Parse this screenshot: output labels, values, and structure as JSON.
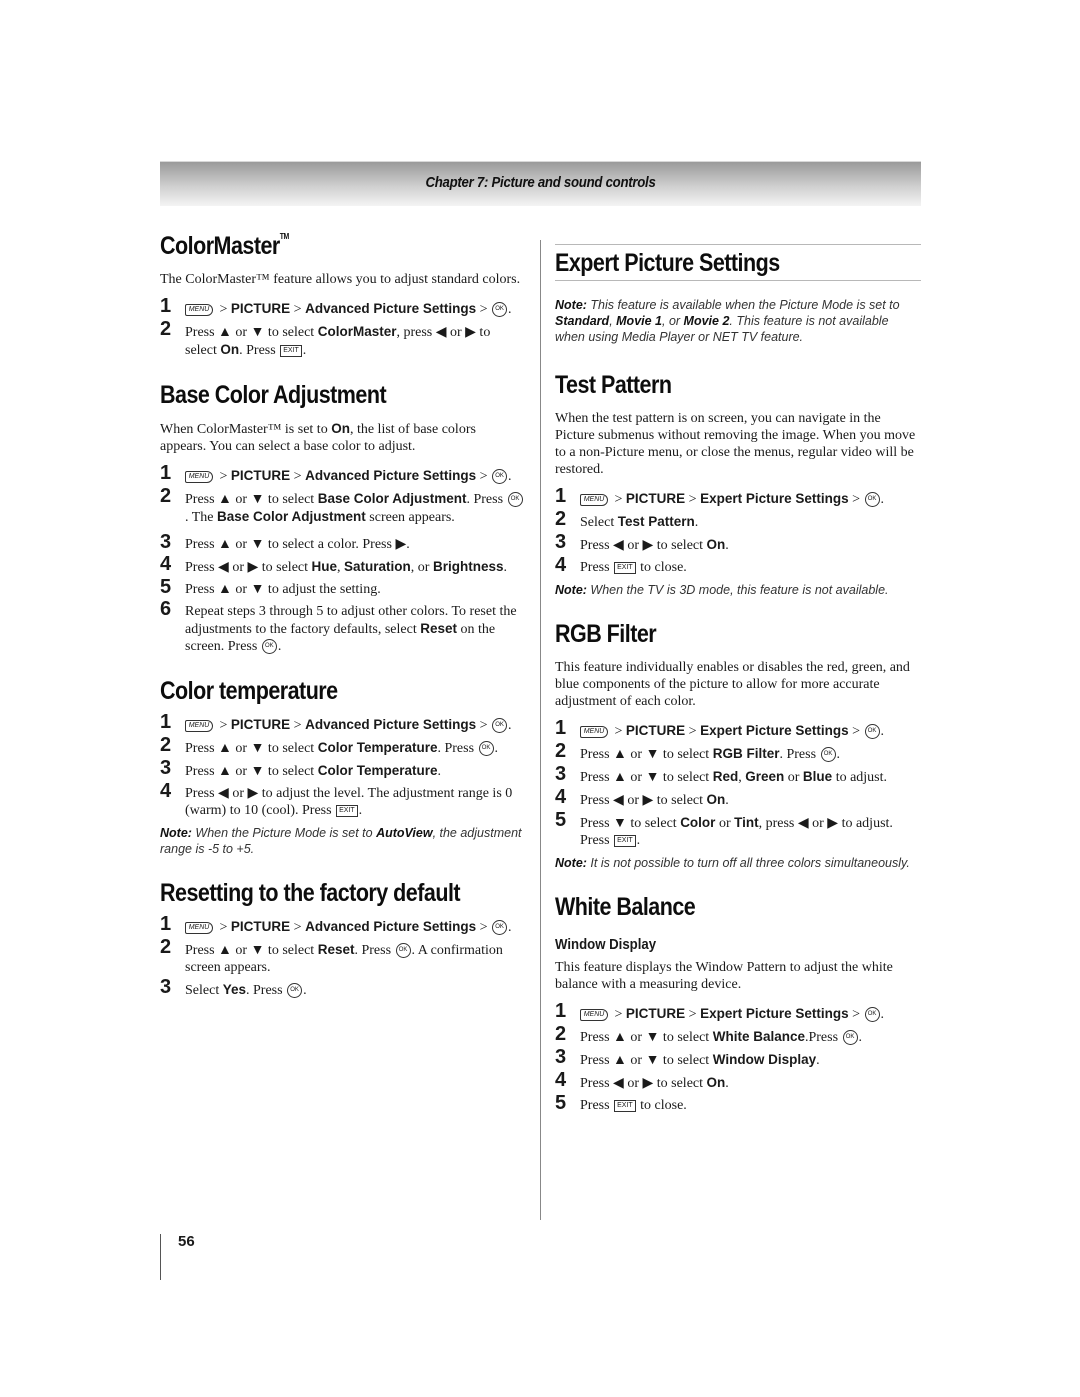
{
  "header": {
    "chapter_title": "Chapter 7: Picture and sound controls"
  },
  "left": {
    "colormaster": {
      "title": "ColorMaster",
      "title_tm": "TM",
      "intro": "The ColorMaster™ feature allows you to adjust standard colors.",
      "steps": [
        {
          "n": "1",
          "menu": "MENU",
          "path": [
            "PICTURE",
            "Advanced Picture Settings"
          ],
          "ok": "OK"
        },
        {
          "n": "2",
          "text_a": "Press ▲ or ▼ to select ",
          "bold_a": "ColorMaster",
          "text_b": ", press ◀ or ▶ to select ",
          "bold_b": "On",
          "text_c": ". Press ",
          "exit": "EXIT",
          "text_d": "."
        }
      ]
    },
    "base_color": {
      "title": "Base Color Adjustment",
      "intro_a": "When ColorMaster™ is set to ",
      "intro_bold": "On",
      "intro_b": ", the list of base colors appears. You can select a base color to adjust.",
      "steps": [
        {
          "n": "1",
          "menu": "MENU",
          "path": [
            "PICTURE",
            "Advanced Picture Settings"
          ],
          "ok": "OK"
        },
        {
          "n": "2",
          "text_a": "Press ▲ or ▼ to select ",
          "bold_a": "Base Color Adjustment",
          "text_b": ". Press ",
          "ok": "OK",
          "text_c": ". The ",
          "bold_b": "Base Color Adjustment",
          "text_d": " screen appears."
        },
        {
          "n": "3",
          "text": "Press ▲ or ▼ to select a color. Press ▶."
        },
        {
          "n": "4",
          "text_a": "Press ◀ or ▶ to select ",
          "bold_a": "Hue",
          "sep1": ", ",
          "bold_b": "Saturation",
          "sep2": ", or ",
          "bold_c": "Brightness",
          "end": "."
        },
        {
          "n": "5",
          "text": "Press ▲ or ▼ to adjust the setting."
        },
        {
          "n": "6",
          "text_a": "Repeat steps 3 through 5 to adjust other colors. To reset the adjustments to the factory defaults, select ",
          "bold_a": "Reset",
          "text_b": " on the screen. Press ",
          "ok": "OK",
          "end": "."
        }
      ]
    },
    "color_temp": {
      "title": "Color temperature",
      "steps": [
        {
          "n": "1",
          "menu": "MENU",
          "path": [
            "PICTURE",
            "Advanced Picture Settings"
          ],
          "ok": "OK"
        },
        {
          "n": "2",
          "text_a": "Press ▲ or ▼ to select ",
          "bold_a": "Color Temperature",
          "text_b": ". Press ",
          "ok": "OK",
          "end": "."
        },
        {
          "n": "3",
          "text_a": "Press ▲ or ▼ to select ",
          "bold_a": "Color Temperature",
          "end": "."
        },
        {
          "n": "4",
          "text_a": "Press ◀ or ▶ to adjust the level. The adjustment range is 0 (warm) to 10 (cool). Press ",
          "exit": "EXIT",
          "end": "."
        }
      ],
      "note_label": "Note:",
      "note_a": " When the Picture Mode is set to ",
      "note_bold": "AutoView",
      "note_b": ", the adjustment range is -5 to +5."
    },
    "reset": {
      "title": "Resetting to the factory default",
      "steps": [
        {
          "n": "1",
          "menu": "MENU",
          "path": [
            "PICTURE",
            "Advanced Picture Settings"
          ],
          "ok": "OK"
        },
        {
          "n": "2",
          "text_a": "Press ▲ or ▼ to select ",
          "bold_a": "Reset",
          "text_b": ". Press ",
          "ok": "OK",
          "text_c": ". A confirmation screen appears."
        },
        {
          "n": "3",
          "text_a": "Select ",
          "bold_a": "Yes",
          "text_b": ". Press ",
          "ok": "OK",
          "end": "."
        }
      ]
    }
  },
  "right": {
    "expert": {
      "title": "Expert Picture Settings",
      "note_label": "Note:",
      "note_a": " This feature is available when the Picture Mode is set to ",
      "note_b1": "Standard",
      "note_sep1": ", ",
      "note_b2": "Movie 1",
      "note_sep2": ", or ",
      "note_b3": "Movie 2",
      "note_c": ". This feature is not available when using Media Player or NET TV feature."
    },
    "test_pattern": {
      "title": "Test Pattern",
      "intro": "When the test pattern is on screen, you can navigate in the Picture submenus without removing the image. When you move to a non-Picture menu, or close the menus, regular video will be restored.",
      "steps": [
        {
          "n": "1",
          "menu": "MENU",
          "path": [
            "PICTURE",
            "Expert Picture Settings"
          ],
          "ok": "OK"
        },
        {
          "n": "2",
          "text_a": "Select ",
          "bold_a": "Test Pattern",
          "end": "."
        },
        {
          "n": "3",
          "text_a": "Press ◀ or ▶ to select ",
          "bold_a": "On",
          "end": "."
        },
        {
          "n": "4",
          "text_a": "Press ",
          "exit": "EXIT",
          "text_b": " to close."
        }
      ],
      "note_label": "Note:",
      "note": " When the TV is 3D mode, this feature is not available."
    },
    "rgb": {
      "title": "RGB Filter",
      "intro": "This feature individually enables or disables the red, green, and blue components of the picture to allow for more accurate adjustment of each color.",
      "steps": [
        {
          "n": "1",
          "menu": "MENU",
          "path": [
            "PICTURE",
            "Expert Picture Settings"
          ],
          "ok": "OK"
        },
        {
          "n": "2",
          "text_a": "Press ▲ or ▼ to select ",
          "bold_a": "RGB Filter",
          "text_b": ". Press ",
          "ok": "OK",
          "end": "."
        },
        {
          "n": "3",
          "text_a": "Press ▲ or ▼ to select ",
          "bold_a": "Red",
          "sep1": ", ",
          "bold_b": "Green",
          "sep2": " or ",
          "bold_c": "Blue",
          "end": " to adjust."
        },
        {
          "n": "4",
          "text_a": "Press ◀ or ▶ to select ",
          "bold_a": "On",
          "end": "."
        },
        {
          "n": "5",
          "text_a": "Press ▼ to select ",
          "bold_a": "Color",
          "sep1": " or ",
          "bold_b": "Tint",
          "text_b": ", press ◀ or ▶ to adjust. Press ",
          "exit": "EXIT",
          "end": "."
        }
      ],
      "note_label": "Note:",
      "note": " It is not possible to turn off all three colors simultaneously."
    },
    "white_balance": {
      "title": "White Balance",
      "subtitle": "Window Display",
      "intro": "This feature displays the Window Pattern to adjust the white balance with a measuring device.",
      "steps": [
        {
          "n": "1",
          "menu": "MENU",
          "path": [
            "PICTURE",
            "Expert Picture Settings"
          ],
          "ok": "OK"
        },
        {
          "n": "2",
          "text_a": "Press ▲ or ▼ to select ",
          "bold_a": "White Balance",
          "text_b": ".Press ",
          "ok": "OK",
          "end": "."
        },
        {
          "n": "3",
          "text_a": "Press ▲ or ▼ to select ",
          "bold_a": "Window Display",
          "end": "."
        },
        {
          "n": "4",
          "text_a": "Press ◀ or ▶ to select ",
          "bold_a": "On",
          "end": "."
        },
        {
          "n": "5",
          "text_a": "Press ",
          "exit": "EXIT",
          "text_b": " to close."
        }
      ]
    }
  },
  "footer": {
    "page_number": "56"
  },
  "labels": {
    "gt": " > "
  }
}
